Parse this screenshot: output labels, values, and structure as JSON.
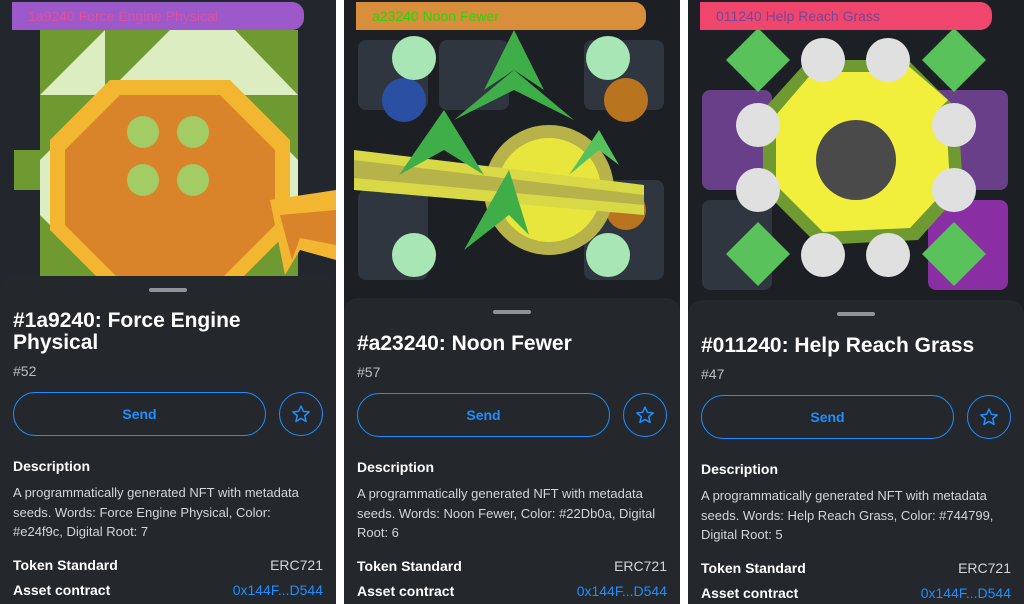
{
  "cards": [
    {
      "art_label": "1a9240 Force Engine Physical",
      "title": "#1a9240: Force Engine Physical",
      "number": "#52",
      "send_label": "Send",
      "description_heading": "Description",
      "description": "A programmatically generated NFT with metadata seeds. Words: Force Engine Physical, Color: #e24f9c, Digital Root: 7",
      "token_standard_label": "Token Standard",
      "token_standard": "ERC721",
      "asset_contract_label": "Asset contract",
      "asset_contract": "0x144F...D544"
    },
    {
      "art_label": "a23240 Noon Fewer",
      "title": "#a23240: Noon Fewer",
      "number": "#57",
      "send_label": "Send",
      "description_heading": "Description",
      "description": "A programmatically generated NFT with metadata seeds. Words: Noon Fewer, Color: #22Db0a, Digital Root: 6",
      "token_standard_label": "Token Standard",
      "token_standard": "ERC721",
      "asset_contract_label": "Asset contract",
      "asset_contract": "0x144F...D544"
    },
    {
      "art_label": "011240 Help Reach Grass",
      "title": "#011240: Help Reach Grass",
      "number": "#47",
      "send_label": "Send",
      "description_heading": "Description",
      "description": "A programmatically generated NFT with metadata seeds. Words: Help Reach Grass, Color: #744799, Digital Root: 5",
      "token_standard_label": "Token Standard",
      "token_standard": "ERC721",
      "asset_contract_label": "Asset contract",
      "asset_contract": "0x144F...D544"
    }
  ],
  "colors": {
    "accent": "#1f8fff",
    "sheet": "#24272c",
    "label_1_bg": "#9b59c9",
    "label_1_text": "#e24f9c",
    "label_2_bg": "#d98e3b",
    "label_2_text": "#22db0a",
    "label_3_bg": "#f0466e",
    "label_3_text": "#744799"
  },
  "icons": {
    "favorite": "star-icon"
  }
}
